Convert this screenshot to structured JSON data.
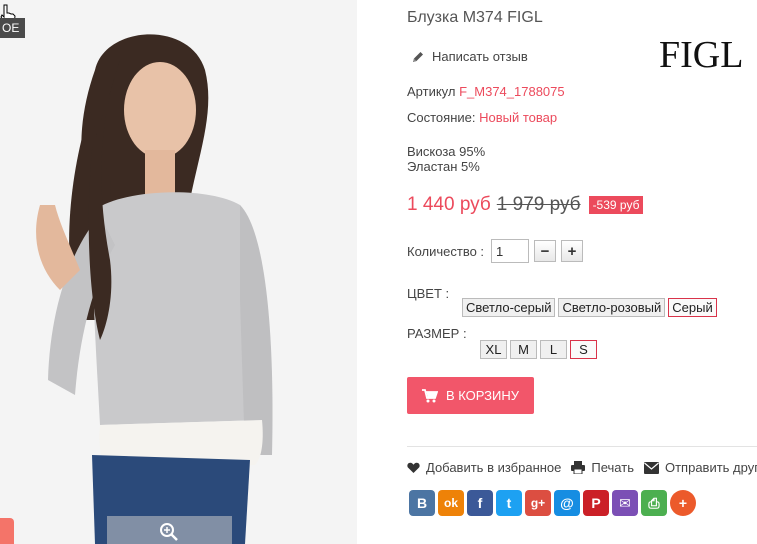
{
  "product": {
    "title": "Блузка M374 FIGL",
    "brand": "FIGL",
    "badge": "ОЕ",
    "review_label": "Написать отзыв",
    "article_label": "Артикул",
    "article_value": "F_M374_1788075",
    "condition_label": "Состояние:",
    "condition_value": "Новый товар",
    "composition": [
      "Вискоза 95%",
      "Эластан 5%"
    ],
    "price": "1 440 руб",
    "old_price": "1 979 руб",
    "discount": "-539 руб"
  },
  "quantity": {
    "label": "Количество :",
    "value": "1",
    "minus": "−",
    "plus": "+"
  },
  "color": {
    "label": "ЦВЕТ :",
    "options": [
      "Светло-серый",
      "Светло-розовый",
      "Серый"
    ],
    "selected": "Серый"
  },
  "size": {
    "label": "РАЗМЕР :",
    "options": [
      "XL",
      "M",
      "L",
      "S"
    ],
    "selected": "S"
  },
  "cart": {
    "label": "В КОРЗИНУ"
  },
  "actions": {
    "favorite": "Добавить в избранное",
    "print": "Печать",
    "send": "Отправить другу"
  },
  "share": {
    "icons": [
      "vk-icon",
      "odnoklassniki-icon",
      "facebook-icon",
      "twitter-icon",
      "googleplus-icon",
      "mailru-icon",
      "pinterest-icon",
      "email-icon",
      "print-share-icon",
      "more-share-icon"
    ],
    "glyphs": [
      "В",
      "ok",
      "f",
      "t",
      "g+",
      "@",
      "P",
      "✉",
      "⎙",
      "+"
    ],
    "colors": [
      "#4c75a3",
      "#ee8208",
      "#3b5998",
      "#1da1f2",
      "#dc4e41",
      "#168de2",
      "#cb2027",
      "#7b4fb5",
      "#4caf50",
      "#ec5a2b"
    ]
  },
  "colors": {
    "accent": "#ec4a5c",
    "button": "#f2566a",
    "sweater": "#c9c9cb",
    "jeans": "#2b4a7a"
  }
}
